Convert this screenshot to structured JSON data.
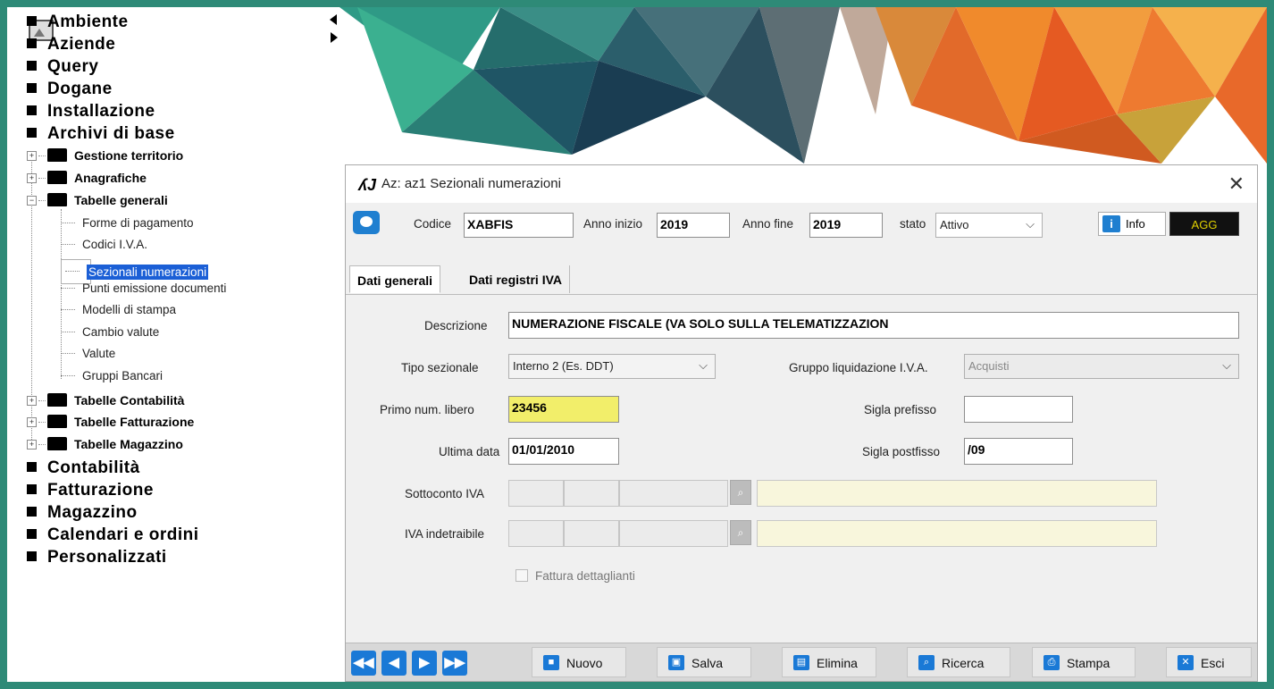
{
  "tree": {
    "top1": [
      "Ambiente",
      "Aziende",
      "Query",
      "Dogane",
      "Installazione",
      "Archivi di base"
    ],
    "folders1": [
      {
        "label": "Gestione territorio",
        "exp": "+"
      },
      {
        "label": "Anagrafiche",
        "exp": "+"
      },
      {
        "label": "Tabelle generali",
        "exp": "−"
      }
    ],
    "leaves": [
      "Forme di pagamento",
      "Codici I.V.A.",
      "Sezionali numerazioni",
      "Punti emissione documenti",
      "Modelli di stampa",
      "Cambio valute",
      "Valute",
      "Gruppi Bancari"
    ],
    "selected_leaf": 2,
    "folders2": [
      {
        "label": "Tabelle Contabilità",
        "exp": "+"
      },
      {
        "label": "Tabelle Fatturazione",
        "exp": "+"
      },
      {
        "label": "Tabelle Magazzino",
        "exp": "+"
      }
    ],
    "top2": [
      "Contabilità",
      "Fatturazione",
      "Magazzino",
      "Calendari e ordini",
      "Personalizzati"
    ]
  },
  "dialog": {
    "title": "Az: az1   Sezionali numerazioni",
    "close": "✕",
    "header": {
      "codice_label": "Codice",
      "codice_value": "XABFIS",
      "anno_inizio_label": "Anno inizio",
      "anno_inizio_value": "2019",
      "anno_fine_label": "Anno fine",
      "anno_fine_value": "2019",
      "stato_label": "stato",
      "stato_value": "Attivo",
      "info_label": "Info",
      "info_icon": "i",
      "agg_label": "AGG"
    },
    "tabs": [
      "Dati generali",
      "Dati registri IVA"
    ],
    "form": {
      "descrizione_label": "Descrizione",
      "descrizione_value": "NUMERAZIONE FISCALE (VA SOLO SULLA TELEMATIZZAZION",
      "tipo_label": "Tipo sezionale",
      "tipo_value": "Interno 2 (Es. DDT)",
      "gruppo_label": "Gruppo liquidazione I.V.A.",
      "gruppo_value": "Acquisti",
      "primo_label": "Primo num. libero",
      "primo_value": "23456",
      "prefisso_label": "Sigla prefisso",
      "prefisso_value": "",
      "ultima_label": "Ultima data",
      "ultima_value": "01/01/2010",
      "postfisso_label": "Sigla postfisso",
      "postfisso_value": "/09",
      "sottoconto_label": "Sottoconto IVA",
      "indetraibile_label": "IVA indetraibile",
      "fattura_label": "Fattura dettaglianti"
    },
    "nav_icons": [
      "◀◀",
      "◀",
      "▶",
      "▶▶"
    ],
    "actions": [
      {
        "label": "Nuovo",
        "icon": "■"
      },
      {
        "label": "Salva",
        "icon": "▣"
      },
      {
        "label": "Elimina",
        "icon": "▤"
      },
      {
        "label": "Ricerca",
        "icon": "⌕"
      },
      {
        "label": "Stampa",
        "icon": "⎙"
      },
      {
        "label": "Esci",
        "icon": "✕"
      }
    ]
  },
  "colors": {
    "frame": "#2e8a77",
    "accent": "#1a79d6",
    "highlight_field": "#f2ee6a",
    "agg_text": "#e0d000"
  }
}
